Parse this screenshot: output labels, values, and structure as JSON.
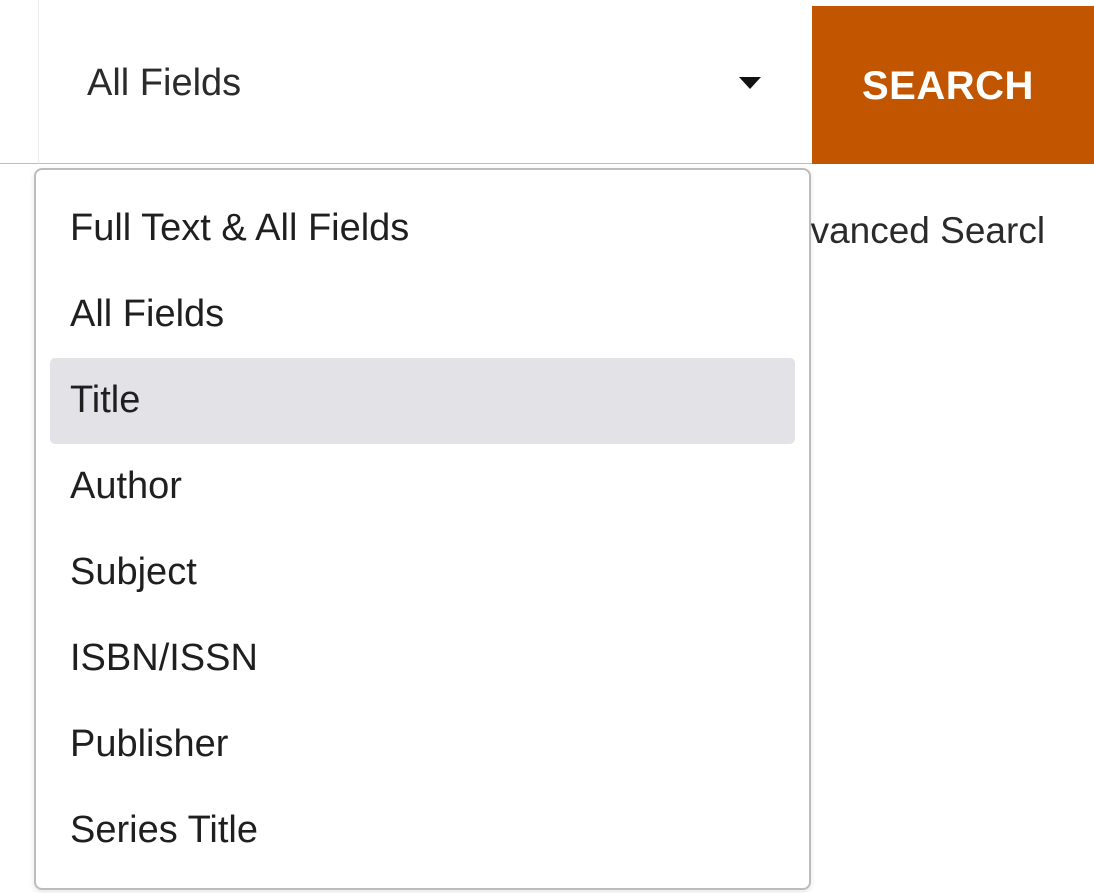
{
  "search_field_select": {
    "value": "All Fields",
    "caret_icon": "caret-down-icon"
  },
  "search_button": {
    "label": "SEARCH",
    "color": "#c25600"
  },
  "advanced_search_link": {
    "label": "dvanced Searcl"
  },
  "dropdown": {
    "highlighted_index": 2,
    "highlight_color": "#e3e3e7",
    "options": [
      {
        "label": "Full Text & All Fields"
      },
      {
        "label": "All Fields"
      },
      {
        "label": "Title"
      },
      {
        "label": "Author"
      },
      {
        "label": "Subject"
      },
      {
        "label": "ISBN/ISSN"
      },
      {
        "label": "Publisher"
      },
      {
        "label": "Series Title"
      }
    ]
  }
}
